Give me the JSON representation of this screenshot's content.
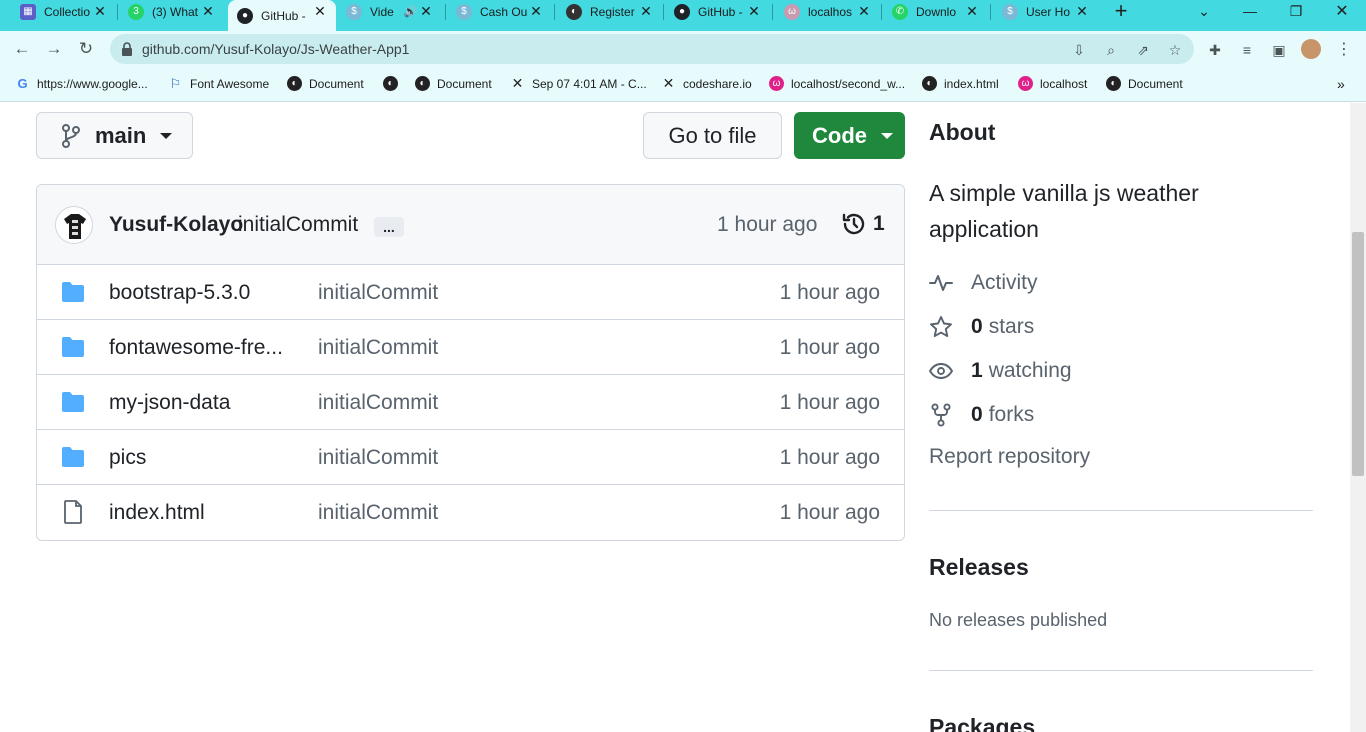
{
  "browser": {
    "tabs": [
      {
        "label": "Collectio",
        "icon": "collection-icon",
        "color": "#5b5fc7"
      },
      {
        "label": "(3) What",
        "icon": "whatsapp-icon",
        "color": "#25d366"
      },
      {
        "label": "GitHub -",
        "icon": "github-icon",
        "color": "#1f2328"
      },
      {
        "label": "Vide",
        "icon": "dollar-icon",
        "color": "#7ab8d6"
      },
      {
        "label": "Cash Ou",
        "icon": "dollar-icon",
        "color": "#7ab8d6"
      },
      {
        "label": "Register",
        "icon": "globe-icon",
        "color": "#333333"
      },
      {
        "label": "GitHub -",
        "icon": "github-icon",
        "color": "#1f2328"
      },
      {
        "label": "localhos",
        "icon": "localhost-icon",
        "color": "#c89bb0"
      },
      {
        "label": "Downlo",
        "icon": "whatsapp-icon",
        "color": "#25d366"
      },
      {
        "label": "User Ho",
        "icon": "dollar-icon",
        "color": "#7ab8d6"
      }
    ],
    "url": "github.com/Yusuf-Kolayo/Js-Weather-App1",
    "bookmarks": [
      {
        "label": "https://www.google...",
        "icon": "google-icon"
      },
      {
        "label": "Font Awesome",
        "icon": "flag-icon"
      },
      {
        "label": "Document",
        "icon": "globe-icon"
      },
      {
        "label": "",
        "icon": "globe-icon"
      },
      {
        "label": "Document",
        "icon": "globe-icon"
      },
      {
        "label": "Sep 07 4:01 AM - C...",
        "icon": "codeshare-icon"
      },
      {
        "label": "codeshare.io",
        "icon": "codeshare-icon"
      },
      {
        "label": "localhost/second_w...",
        "icon": "localhost-icon"
      },
      {
        "label": "index.html",
        "icon": "globe-icon"
      },
      {
        "label": "localhost",
        "icon": "localhost-icon"
      },
      {
        "label": "Document",
        "icon": "globe-icon"
      }
    ]
  },
  "repo": {
    "branch": "main",
    "go_to_file": "Go to file",
    "code_button": "Code",
    "commit": {
      "author": "Yusuf-Kolayo",
      "message": "initialCommit",
      "ellipsis": "...",
      "time": "1 hour ago",
      "count": "1"
    },
    "files": [
      {
        "name": "bootstrap-5.3.0",
        "type": "folder",
        "message": "initialCommit",
        "time": "1 hour ago"
      },
      {
        "name": "fontawesome-fre...",
        "type": "folder",
        "message": "initialCommit",
        "time": "1 hour ago"
      },
      {
        "name": "my-json-data",
        "type": "folder",
        "message": "initialCommit",
        "time": "1 hour ago"
      },
      {
        "name": "pics",
        "type": "folder",
        "message": "initialCommit",
        "time": "1 hour ago"
      },
      {
        "name": "index.html",
        "type": "file",
        "message": "initialCommit",
        "time": "1 hour ago"
      }
    ]
  },
  "sidebar": {
    "about_title": "About",
    "description": "A simple vanilla js weather application",
    "activity": "Activity",
    "stars_count": "0",
    "stars_label": "stars",
    "watching_count": "1",
    "watching_label": "watching",
    "forks_count": "0",
    "forks_label": "forks",
    "report": "Report repository",
    "releases_title": "Releases",
    "releases_empty": "No releases published",
    "packages_title": "Packages"
  },
  "colors": {
    "tabbar": "#42d9e0",
    "code_button": "#1f883d",
    "folder": "#54aeff"
  }
}
